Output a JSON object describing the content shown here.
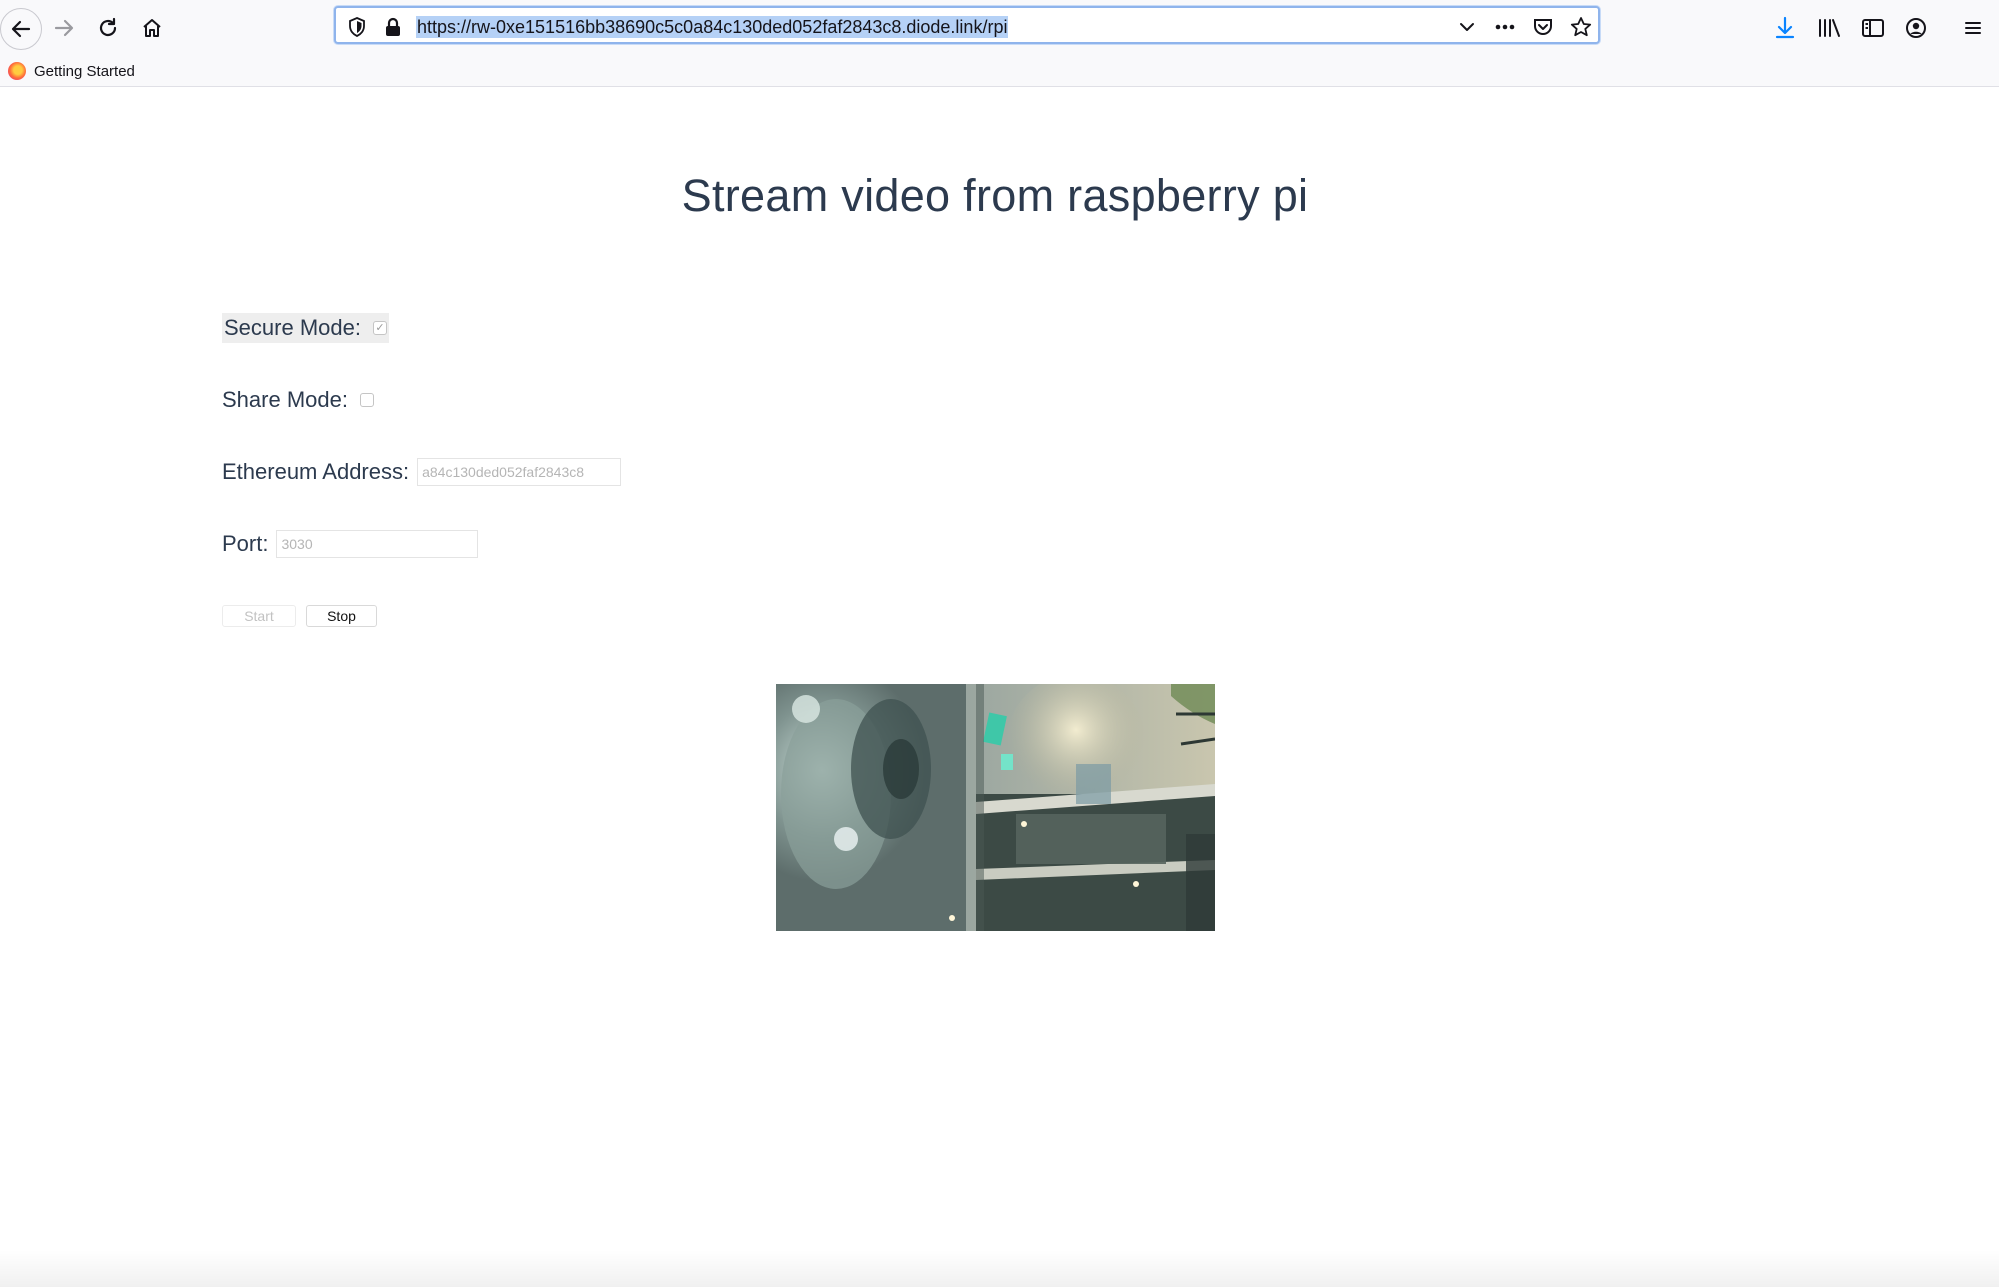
{
  "browser": {
    "url": "https://rw-0xe151516bb38690c5c0a84c130ded052faf2843c8.diode.link/rpi",
    "bookmarks": [
      {
        "label": "Getting Started"
      }
    ]
  },
  "page": {
    "title": "Stream video from raspberry pi",
    "secure_mode": {
      "label": "Secure Mode:",
      "checked": true
    },
    "share_mode": {
      "label": "Share Mode:",
      "checked": false
    },
    "ethereum_address": {
      "label": "Ethereum Address:",
      "placeholder": "a84c130ded052faf2843c8"
    },
    "port": {
      "label": "Port:",
      "placeholder": "3030"
    },
    "buttons": {
      "start": "Start",
      "stop": "Stop"
    }
  }
}
